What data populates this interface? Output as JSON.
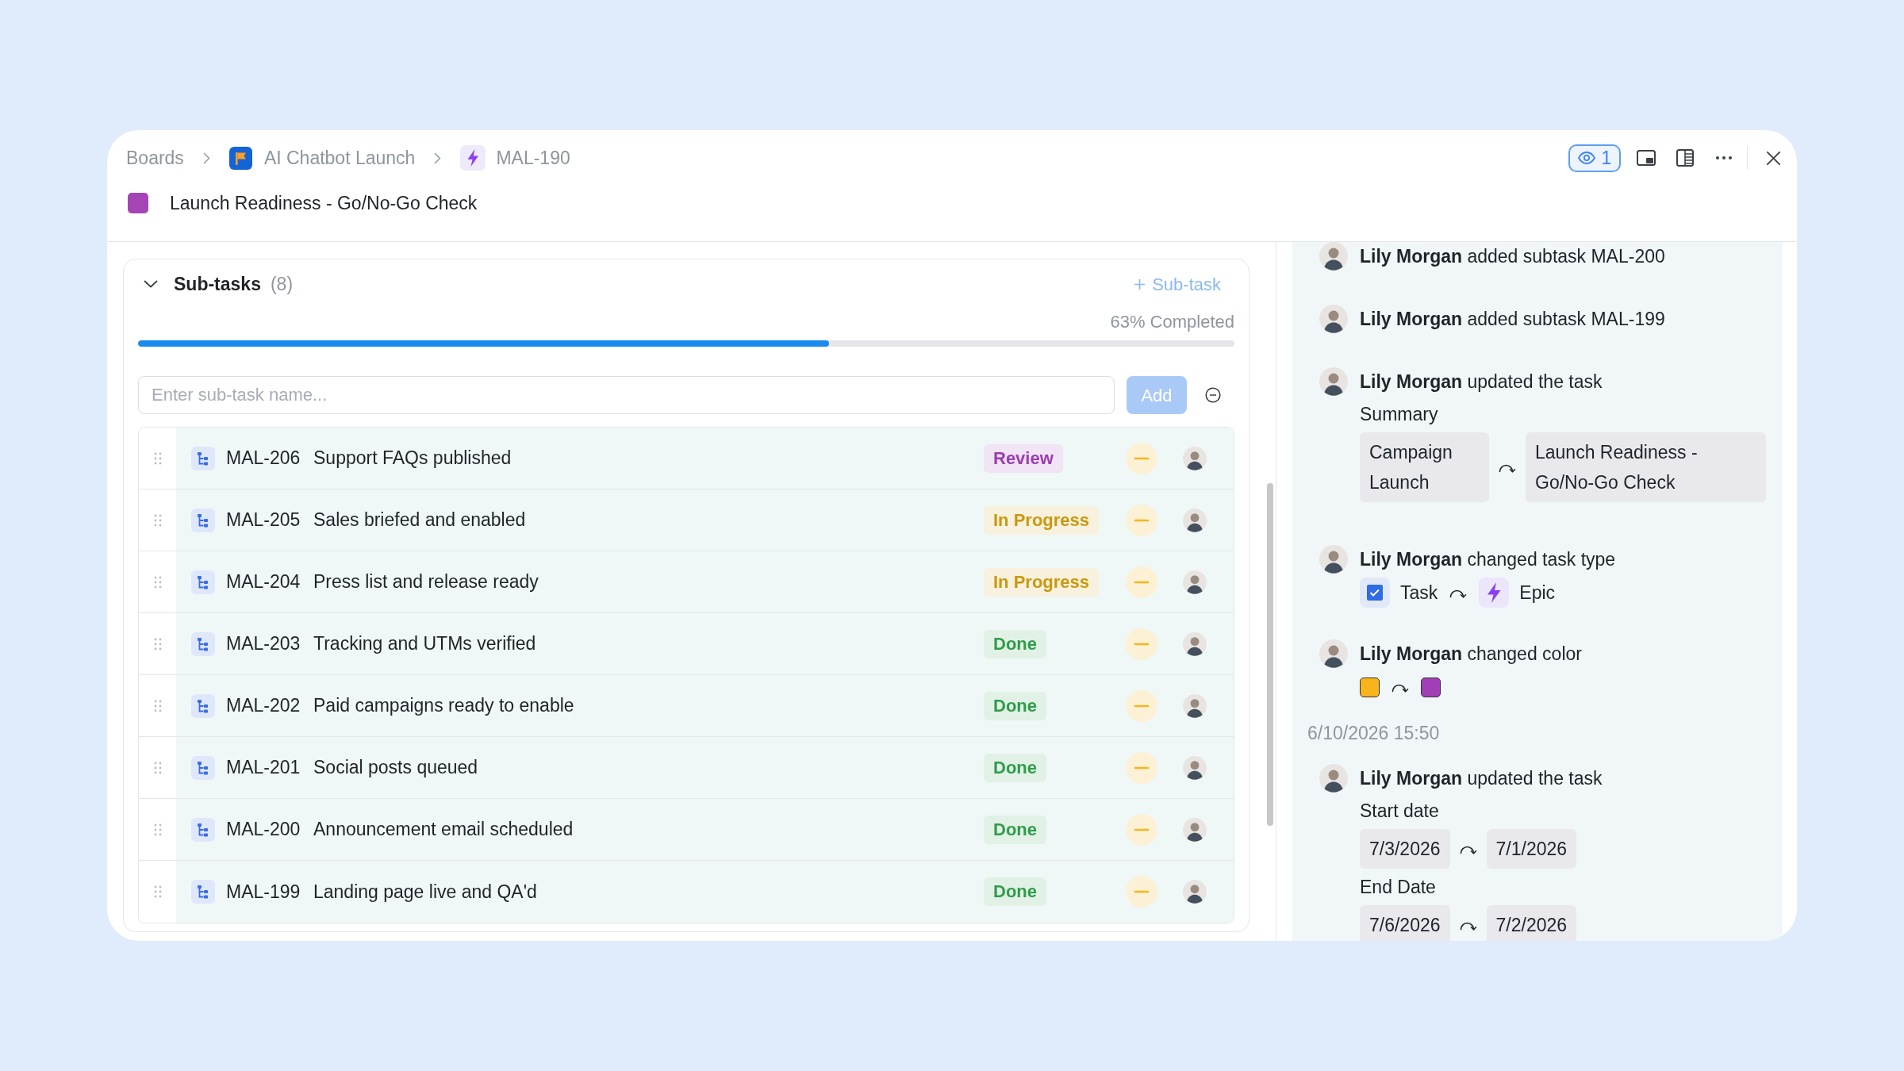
{
  "breadcrumbs": [
    {
      "label": "Boards",
      "kind": "board"
    },
    {
      "label": "AI Chatbot Launch",
      "kind": "project"
    },
    {
      "label": "MAL-190",
      "kind": "epic"
    }
  ],
  "task": {
    "title": "Launch Readiness - Go/No-Go Check",
    "color": "#a545b5"
  },
  "toolbar": {
    "watchers": "1"
  },
  "subtasks": {
    "title": "Sub-tasks",
    "count": "(8)",
    "expanded": true,
    "add_label": "Sub-task",
    "progress": {
      "label": "63% Completed",
      "level": 0.63
    },
    "input": {
      "placeholder": "Enter sub-task name..."
    },
    "add_button": {
      "label": "Add",
      "disabled": true
    },
    "rows": [
      {
        "id": "MAL-206",
        "title": "Support FAQs published",
        "status": {
          "label": "Review",
          "color": "#9b3db3"
        }
      },
      {
        "id": "MAL-205",
        "title": "Sales briefed and enabled",
        "status": {
          "label": "In Progress",
          "color": "#c9990f"
        }
      },
      {
        "id": "MAL-204",
        "title": "Press list and release ready",
        "status": {
          "label": "In Progress",
          "color": "#c9990f"
        }
      },
      {
        "id": "MAL-203",
        "title": "Tracking and UTMs verified",
        "status": {
          "label": "Done",
          "color": "#2e9d4a"
        }
      },
      {
        "id": "MAL-202",
        "title": "Paid campaigns ready to enable",
        "status": {
          "label": "Done",
          "color": "#2e9d4a"
        }
      },
      {
        "id": "MAL-201",
        "title": "Social posts queued",
        "status": {
          "label": "Done",
          "color": "#2e9d4a"
        }
      },
      {
        "id": "MAL-200",
        "title": "Announcement email scheduled",
        "status": {
          "label": "Done",
          "color": "#2e9d4a"
        }
      },
      {
        "id": "MAL-199",
        "title": "Landing page live and QA'd",
        "status": {
          "label": "Done",
          "color": "#2e9d4a"
        }
      }
    ]
  },
  "activity": [
    {
      "kind": "event",
      "text": "**Lily Morgan** added subtask MAL-200"
    },
    {
      "kind": "event",
      "text": "**Lily Morgan** added subtask MAL-199"
    },
    {
      "kind": "field_change",
      "text": "**Lily Morgan** updated the task",
      "changes": [
        {
          "field": "Summary",
          "from": "Campaign Launch",
          "to": "Launch Readiness - Go/No-Go Check"
        }
      ]
    },
    {
      "kind": "type_change",
      "text": "**Lily Morgan** changed task type",
      "from": {
        "label": "Task",
        "kind": "task"
      },
      "to": {
        "label": "Epic",
        "kind": "epic"
      }
    },
    {
      "kind": "color_change",
      "text": "**Lily Morgan** changed color",
      "swatches": [
        {
          "color": "#f9b41d"
        },
        {
          "color": "#a33fb6"
        }
      ]
    },
    {
      "kind": "timestamp",
      "text": "6/10/2026 15:50"
    },
    {
      "kind": "field_change",
      "text": "**Lily Morgan** updated the task",
      "changes": [
        {
          "field": "Start date",
          "from": "7/3/2026",
          "to": "7/1/2026"
        },
        {
          "field": "End Date",
          "from": "7/6/2026",
          "to": "7/2/2026"
        }
      ]
    }
  ]
}
